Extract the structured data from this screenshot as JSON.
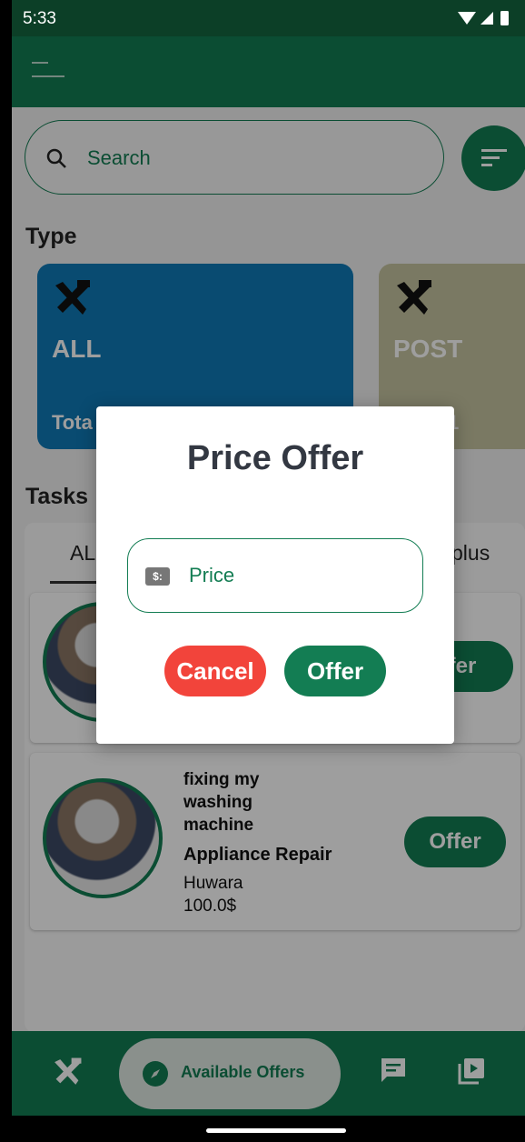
{
  "status_bar": {
    "time": "5:33"
  },
  "search": {
    "placeholder": "Search"
  },
  "type_section": {
    "title": "Type"
  },
  "type_cards": [
    {
      "title": "ALL",
      "subtitle": "Tota"
    },
    {
      "title": "POST",
      "subtitle": "1"
    }
  ],
  "tasks_section": {
    "title": "Tasks"
  },
  "task_tabs": [
    {
      "label": "AL"
    },
    {
      "label": "plus"
    }
  ],
  "tasks": [
    {
      "offer_label": "fer"
    },
    {
      "title": "fixing my washing machine",
      "category": "Appliance Repair",
      "location": "Huwara",
      "price": "100.0$",
      "offer_label": "Offer"
    }
  ],
  "bottom_nav": {
    "active_label": "Available Offers"
  },
  "dialog": {
    "title": "Price Offer",
    "price_placeholder": "Price",
    "price_icon_glyph": "$:",
    "cancel_label": "Cancel",
    "offer_label": "Offer"
  },
  "colors": {
    "primary": "#137d53",
    "status_bar": "#0c3f27",
    "cancel": "#f2443b",
    "all_card": "#0f7ab6",
    "post_card": "#c5c4a0"
  },
  "icons": [
    "menu-icon",
    "search-icon",
    "filter-icon",
    "tools-icon",
    "compass-icon",
    "chat-icon",
    "video-library-icon",
    "price-tag-icon"
  ]
}
